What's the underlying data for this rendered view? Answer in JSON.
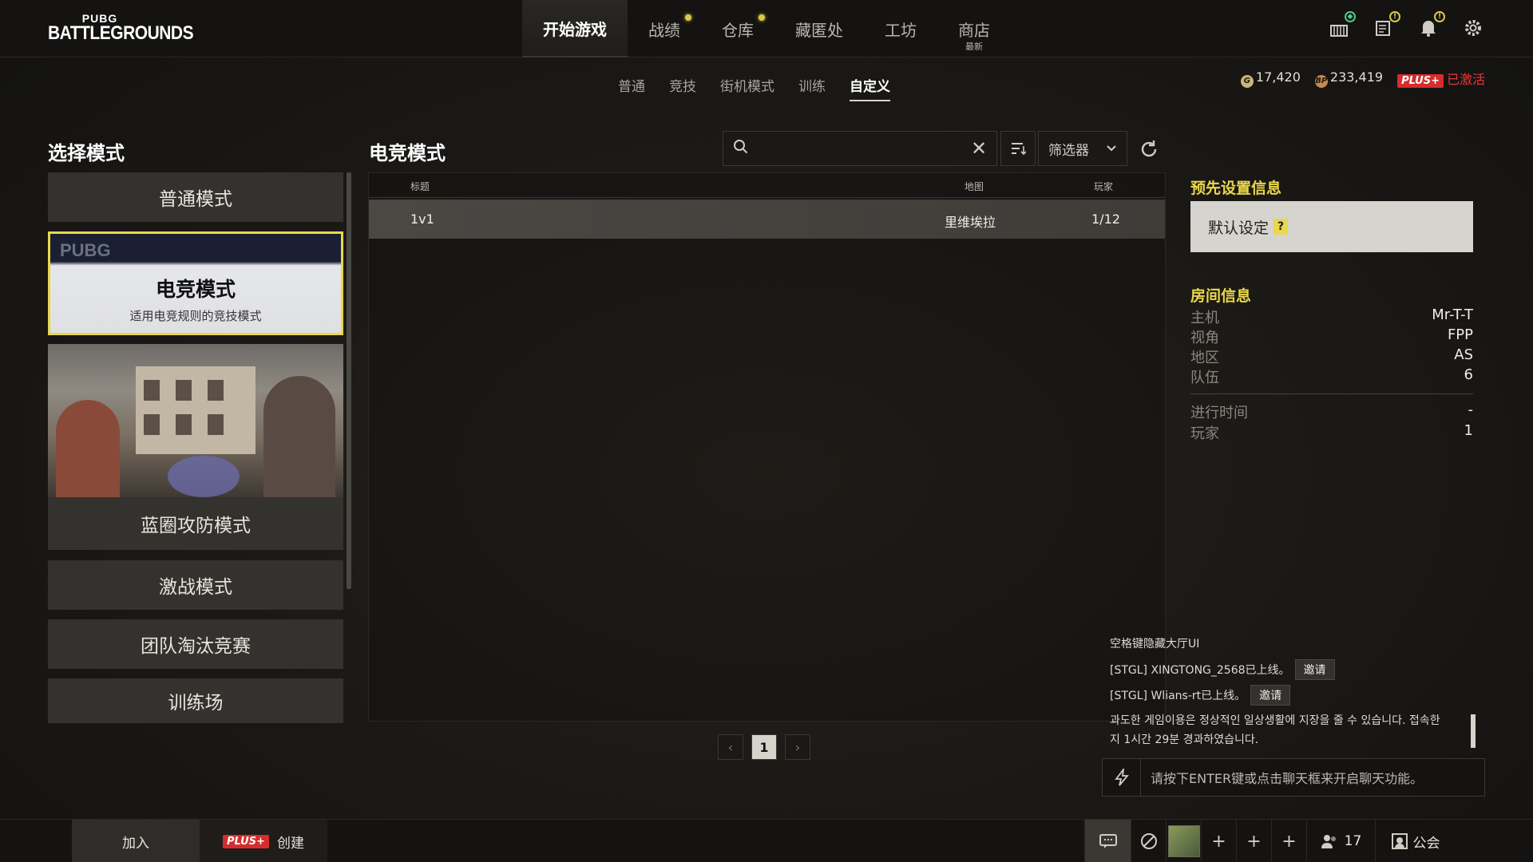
{
  "app": {
    "logo_top": "PUBG",
    "logo_bottom": "BATTLEGROUNDS"
  },
  "main_nav": {
    "items": [
      {
        "label": "开始游戏",
        "active": true
      },
      {
        "label": "战绩",
        "dot": true
      },
      {
        "label": "仓库",
        "dot": true
      },
      {
        "label": "藏匿处"
      },
      {
        "label": "工坊"
      },
      {
        "label": "商店",
        "sub": "最新"
      }
    ]
  },
  "top_icons": [
    "store-icon",
    "mission-icon",
    "notification-icon",
    "settings-icon"
  ],
  "sub_nav": {
    "items": [
      "普通",
      "竞技",
      "街机模式",
      "训练",
      "自定义"
    ],
    "active_index": 4
  },
  "currency": {
    "g_coin": "17,420",
    "bp": "233,419",
    "plus_label": "PLUS+",
    "status": "已激活"
  },
  "left": {
    "title": "选择模式",
    "modes": {
      "normal": "普通模式",
      "esports": {
        "title": "电竞模式",
        "desc": "适用电竞规则的竞技模式",
        "brand": "PUBG"
      },
      "bluezone": "蓝圈攻防模式",
      "intense": "激战模式",
      "team_elim": "团队淘汰竞赛",
      "training": "训练场"
    }
  },
  "center": {
    "title": "电竞模式",
    "search": {
      "value": "",
      "placeholder": ""
    },
    "filter_label": "筛选器",
    "columns": {
      "title": "标题",
      "map": "地图",
      "players": "玩家"
    },
    "rows": [
      {
        "title": "1v1",
        "map": "里维埃拉",
        "players": "1/12"
      }
    ],
    "page": "1"
  },
  "right": {
    "preset_title": "预先设置信息",
    "preset_value": "默认设定",
    "preset_help": "?",
    "room_title": "房间信息",
    "room": [
      {
        "k": "主机",
        "v": "Mr-T-T"
      },
      {
        "k": "视角",
        "v": "FPP"
      },
      {
        "k": "地区",
        "v": "AS"
      },
      {
        "k": "队伍",
        "v": "6"
      }
    ],
    "status": [
      {
        "k": "进行时间",
        "v": "-"
      },
      {
        "k": "玩家",
        "v": "1"
      }
    ]
  },
  "chat": {
    "hint": "空格键隐藏大厅UI",
    "msg1": "[STGL] XINGTONG_2568已上线。",
    "msg2": "[STGL] Wlians-rt已上线。",
    "invite": "邀请",
    "notice1": "과도한 게임이용은 정상적인 일상생활에 지장을 줄 수 있습니다. 접속한",
    "notice2": "지 1시간 29분 경과하였습니다.",
    "input_placeholder": "请按下ENTER键或点击聊天框来开启聊天功能。"
  },
  "bottom": {
    "join": "加入",
    "plus": "PLUS+",
    "create": "创建",
    "friends_count": "17",
    "guild": "公会"
  },
  "colors": {
    "accent_yellow": "#e9d84a",
    "plus_red": "#d62c2c",
    "panel": "#34322e",
    "bg": "#1c1a17"
  }
}
